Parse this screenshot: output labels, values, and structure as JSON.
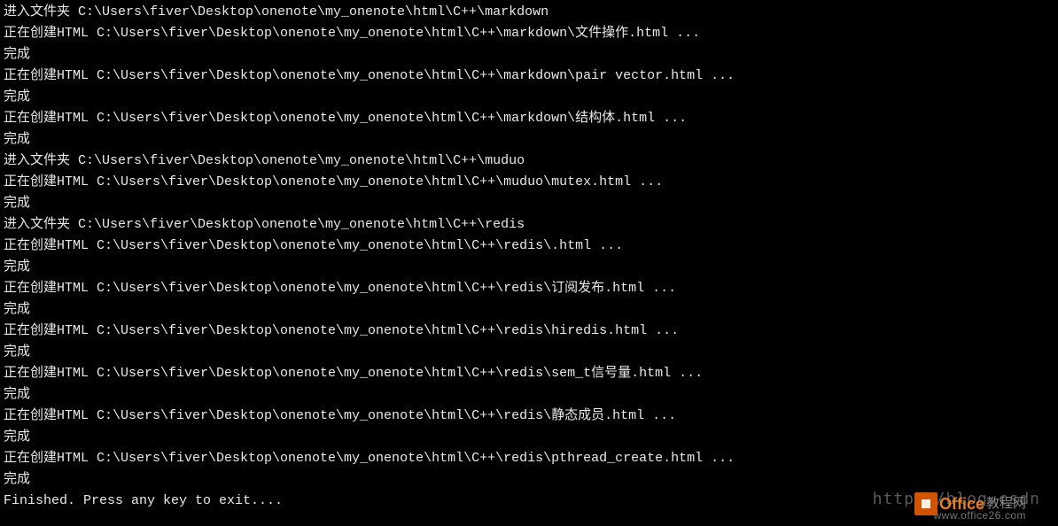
{
  "terminal": {
    "lines": [
      "进入文件夹 C:\\Users\\fiver\\Desktop\\onenote\\my_onenote\\html\\C++\\markdown",
      "正在创建HTML C:\\Users\\fiver\\Desktop\\onenote\\my_onenote\\html\\C++\\markdown\\文件操作.html ...",
      "完成",
      "正在创建HTML C:\\Users\\fiver\\Desktop\\onenote\\my_onenote\\html\\C++\\markdown\\pair vector.html ...",
      "完成",
      "正在创建HTML C:\\Users\\fiver\\Desktop\\onenote\\my_onenote\\html\\C++\\markdown\\结构体.html ...",
      "完成",
      "进入文件夹 C:\\Users\\fiver\\Desktop\\onenote\\my_onenote\\html\\C++\\muduo",
      "正在创建HTML C:\\Users\\fiver\\Desktop\\onenote\\my_onenote\\html\\C++\\muduo\\mutex.html ...",
      "完成",
      "进入文件夹 C:\\Users\\fiver\\Desktop\\onenote\\my_onenote\\html\\C++\\redis",
      "正在创建HTML C:\\Users\\fiver\\Desktop\\onenote\\my_onenote\\html\\C++\\redis\\.html ...",
      "完成",
      "正在创建HTML C:\\Users\\fiver\\Desktop\\onenote\\my_onenote\\html\\C++\\redis\\订阅发布.html ...",
      "完成",
      "正在创建HTML C:\\Users\\fiver\\Desktop\\onenote\\my_onenote\\html\\C++\\redis\\hiredis.html ...",
      "完成",
      "正在创建HTML C:\\Users\\fiver\\Desktop\\onenote\\my_onenote\\html\\C++\\redis\\sem_t信号量.html ...",
      "完成",
      "正在创建HTML C:\\Users\\fiver\\Desktop\\onenote\\my_onenote\\html\\C++\\redis\\静态成员.html ...",
      "完成",
      "正在创建HTML C:\\Users\\fiver\\Desktop\\onenote\\my_onenote\\html\\C++\\redis\\pthread_create.html ...",
      "完成",
      "Finished. Press any key to exit...."
    ]
  },
  "watermark": {
    "url": "http://blog.csdn",
    "officeText": "Office",
    "suffixText": "教程网",
    "subText": "www.office26.com"
  }
}
